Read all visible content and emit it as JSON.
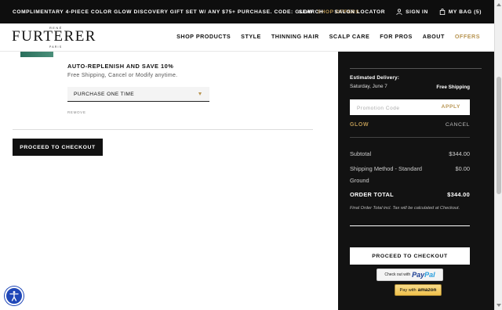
{
  "promo_bar": {
    "message": "COMPLIMENTARY 4-PIECE COLOR GLOW DISCOVERY GIFT SET W/ ANY $75+ PURCHASE. CODE: GLOW",
    "link": "SHOP OFFERS",
    "utility": {
      "search": "SEARCH",
      "salon_locator": "SALON LOCATOR",
      "sign_in": "SIGN IN",
      "bag": "MY BAG (5)"
    }
  },
  "header": {
    "logo": {
      "top": "RENÉ",
      "name": "FURTERER",
      "bottom": "PARIS"
    },
    "nav": [
      "SHOP PRODUCTS",
      "STYLE",
      "THINNING HAIR",
      "SCALP CARE",
      "FOR PROS",
      "ABOUT",
      "OFFERS"
    ]
  },
  "cart_item": {
    "replenish_title": "AUTO-REPLENISH AND SAVE 10%",
    "replenish_sub": "Free Shipping, Cancel or Modify anytime.",
    "purchase_option": "PURCHASE ONE TIME",
    "remove": "REMOVE",
    "checkout_button": "PROCEED TO CHECKOUT"
  },
  "summary": {
    "estimated_delivery_label": "Estimated Delivery:",
    "estimated_delivery_date": "Saturday, June 7",
    "estimated_delivery_shipping": "Free Shipping",
    "promo_placeholder": "Promotion Code",
    "apply": "APPLY",
    "applied_code": "GLOW",
    "cancel": "CANCEL",
    "subtotal_label": "Subtotal",
    "subtotal_value": "$344.00",
    "shipping_label": "Shipping Method - Standard Ground",
    "shipping_value": "$0.00",
    "total_label": "ORDER TOTAL",
    "total_value": "$344.00",
    "note": "Final Order Total incl. Tax will be calculated at Checkout.",
    "checkout_button": "PROCEED TO CHECKOUT",
    "paypal_prefix": "Check out with",
    "paypal_pay": "Pay",
    "paypal_pal": "Pal",
    "amazon_prefix": "Pay with",
    "amazon_brand": "amazon"
  },
  "colors": {
    "accent": "#b89552",
    "dark": "#121212",
    "a11y": "#1f47b8"
  },
  "icons": [
    "user-icon",
    "bag-icon",
    "caret-down-icon",
    "accessibility-icon"
  ]
}
